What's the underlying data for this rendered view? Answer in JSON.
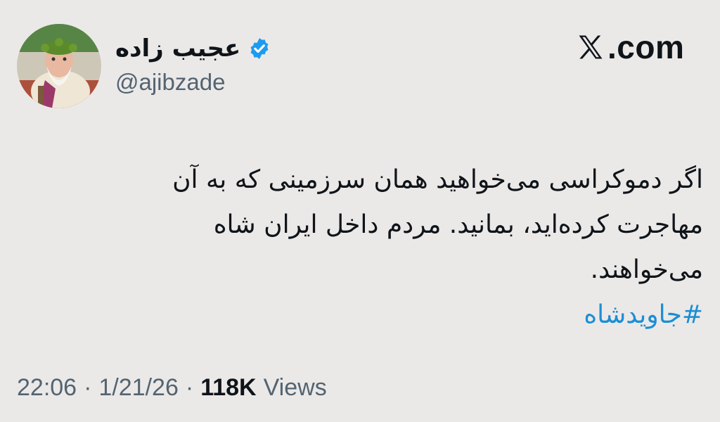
{
  "author": {
    "display_name": "عجیب زاده",
    "handle": "@ajibzade",
    "verified": true
  },
  "brand": {
    "text": ".com",
    "icon": "x-logo-icon"
  },
  "tweet": {
    "lines": [
      "اگر دموکراسی می‌خواهید همان سرزمینی که به آن",
      "مهاجرت کرده‌اید، بمانید. مردم داخل ایران شاه",
      "می‌خواهند."
    ],
    "hashtag": "#جاویدشاه"
  },
  "meta": {
    "time": "22:06",
    "date": "1/21/26",
    "views_count": "118K",
    "views_label": "Views",
    "separator": "·"
  },
  "colors": {
    "background": "#ebe9e8",
    "text": "#0f1419",
    "secondary": "#536471",
    "link": "#1d8ed4",
    "verified": "#1d9bf0"
  }
}
